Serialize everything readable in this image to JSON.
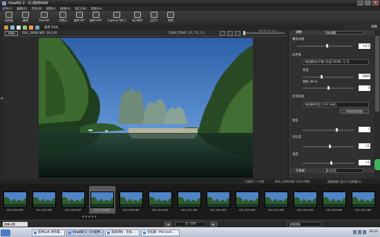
{
  "window": {
    "title": "ViewNX 2 - G:\\桂林RAW"
  },
  "menu": [
    "文件(F)",
    "编辑(E)",
    "浏览(B)",
    "图像(I)",
    "视图(V)",
    "窗口(W)",
    "帮助(H)"
  ],
  "toolbar": [
    {
      "label": "浏览器",
      "icon": "browser-icon"
    },
    {
      "label": "编辑",
      "icon": "edit-icon"
    },
    {
      "label": "Transfer",
      "icon": "transfer-icon"
    },
    {
      "label": "对焦点",
      "icon": "focus-icon"
    },
    {
      "label": "旋转-90°",
      "icon": "rotate-left-icon"
    },
    {
      "label": "旋转+90°",
      "icon": "rotate-right-icon"
    },
    {
      "label": "Capture NX 2",
      "icon": "capture-nx-icon"
    },
    {
      "label": "电子邮件",
      "icon": "email-icon"
    },
    {
      "label": "幻灯片",
      "icon": "slideshow-icon"
    },
    {
      "label": "转换",
      "icon": "convert-icon"
    }
  ],
  "iconrow": {
    "label": "排序 RGB"
  },
  "right_tab": "调整",
  "view": {
    "badge": "RAW",
    "filename": "DSC_0008.NEF",
    "size": "19.2 M",
    "coords": "2303,1500 ( 27, 71, 3 )",
    "zoom_label": "100 50 25 12.5 ..."
  },
  "panel": {
    "header": "调整",
    "preset": "所有调整",
    "exposure_label": "曝光补偿",
    "exposure_value": "+0.3",
    "wb_label": "白平衡",
    "wb_select": "如拍摄时白平衡 (色温 5000K, 0, 0)",
    "temp_label": "色温",
    "temp_value": "5000",
    "tint_label": "调色 (M-G)",
    "tint_value": "0",
    "picture_label": "优化校准",
    "picture_select": "如拍摄时设定 (CSC 标准)",
    "apply_btn": "启动优化校准",
    "sharp_label": "锐化",
    "sharp_value": "7",
    "contrast_label": "对比度",
    "contrast_value": "11",
    "bright_label": "亮度",
    "bright_value": "+1",
    "footer_left": "元数据",
    "footer_right": "基本信息"
  },
  "status": {
    "left": "已选择 1 个文件",
    "mid": "DSC_0008.NEF (19.2 MB)",
    "right": "图像视图 (显示于当前窗口)"
  },
  "filmstrip": [
    "DSC_0004.NEF",
    "DSC_0005.NEF",
    "DSC_0006.NEF",
    "DSC_0008.NEF",
    "DSC_0009.NEF",
    "DSC_0010.NEF",
    "DSC_0011.NEF",
    "DSC_0012.NEF",
    "DSC_0013.NEF",
    "DSC_0014.NEF",
    "DSC_0015.NEF",
    "DSC_0016.NEF",
    "DSC_0017.NEF"
  ],
  "nav": {
    "input": "图像元素",
    "page": "4 / 100",
    "view_select": "查看图像"
  },
  "taskbar": {
    "start": "",
    "tasks": [
      "桂林山水 改作版...",
      "ViewNX 2 - G:\\桂林...",
      "发表新帖 - 无标...",
      "无标题 - Microsof..."
    ],
    "clock": "18:23"
  },
  "colors": {
    "green_btn": "#3cb55a",
    "sky": "#3f74b8"
  }
}
